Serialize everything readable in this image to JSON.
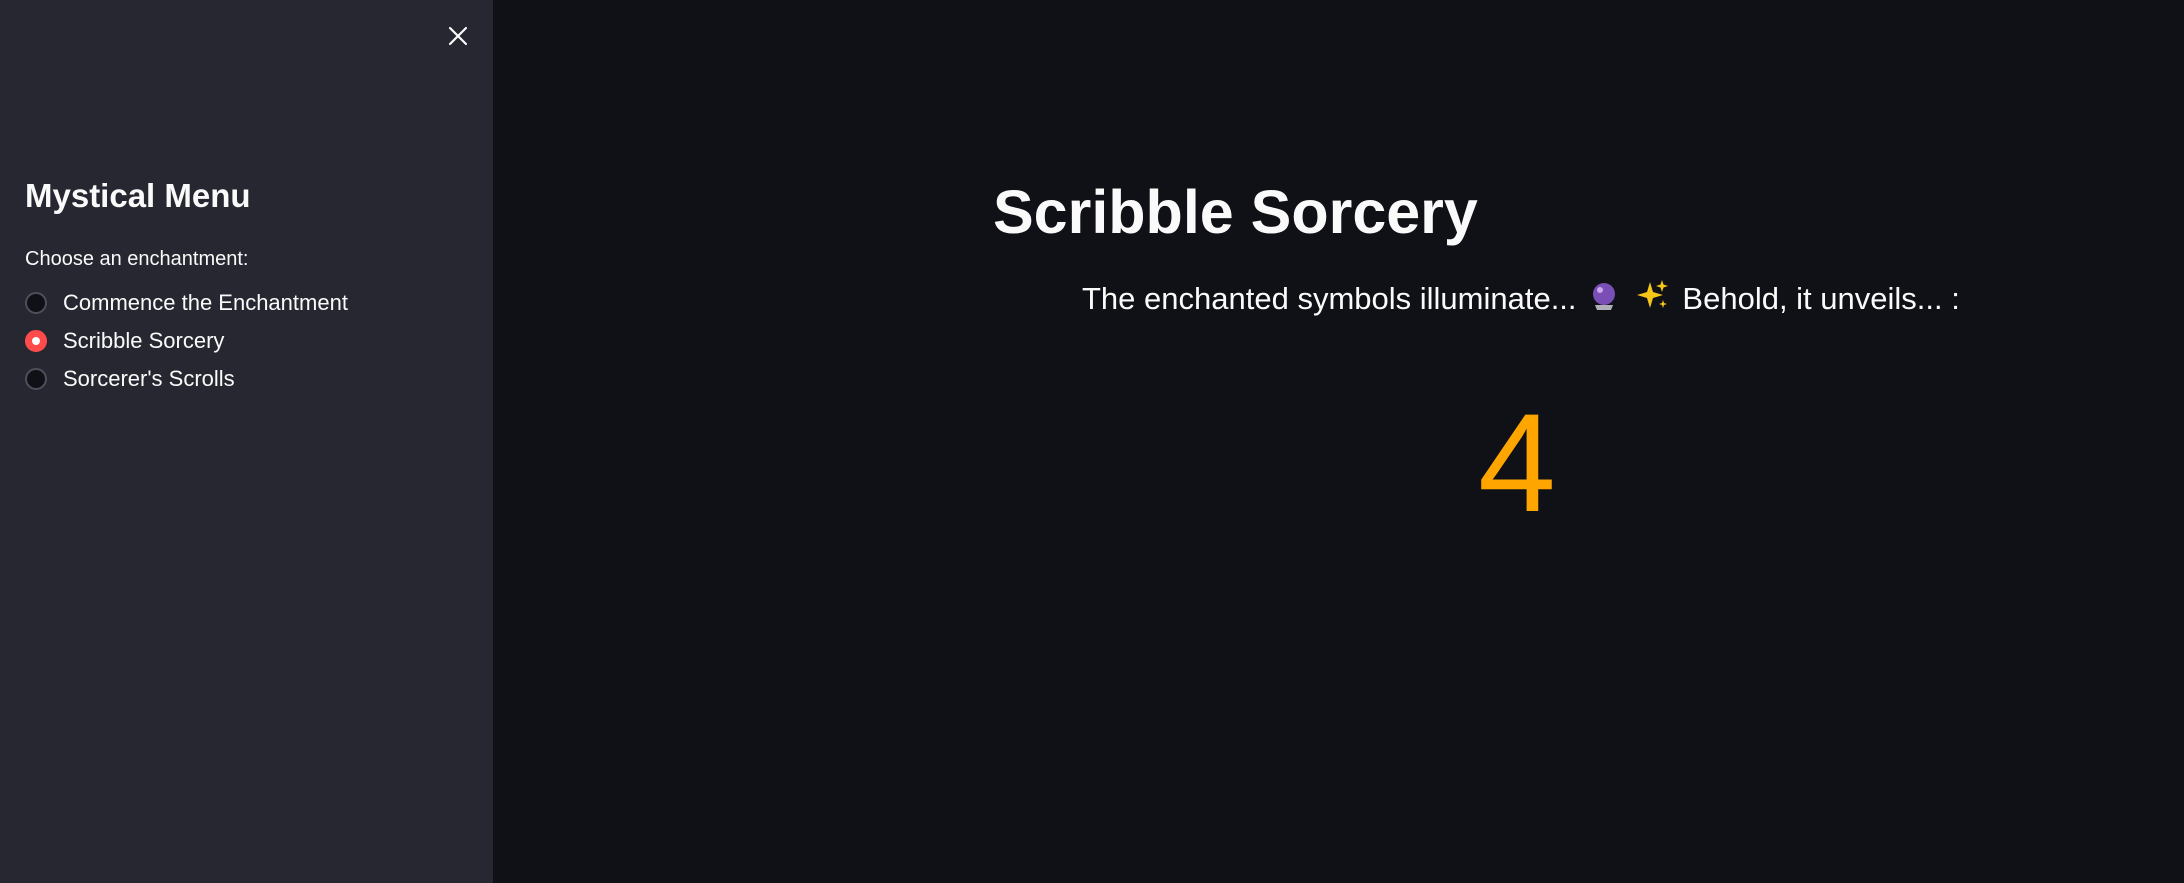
{
  "sidebar": {
    "title": "Mystical Menu",
    "radio_label": "Choose an enchantment:",
    "options": [
      {
        "label": "Commence the Enchantment",
        "selected": false
      },
      {
        "label": "Scribble Sorcery",
        "selected": true
      },
      {
        "label": "Sorcerer's Scrolls",
        "selected": false
      }
    ],
    "close_icon": "close-icon"
  },
  "main": {
    "title": "Scribble Sorcery",
    "subtitle_before": "The enchanted symbols illuminate...",
    "subtitle_emojis": [
      "crystal-ball-icon",
      "sparkles-icon"
    ],
    "subtitle_after": "Behold, it unveils... :",
    "result": "4"
  },
  "colors": {
    "background": "#0f1117",
    "sidebar": "#262730",
    "accent": "#ff4b4b",
    "result": "#ffa500",
    "text": "#fafafa"
  }
}
